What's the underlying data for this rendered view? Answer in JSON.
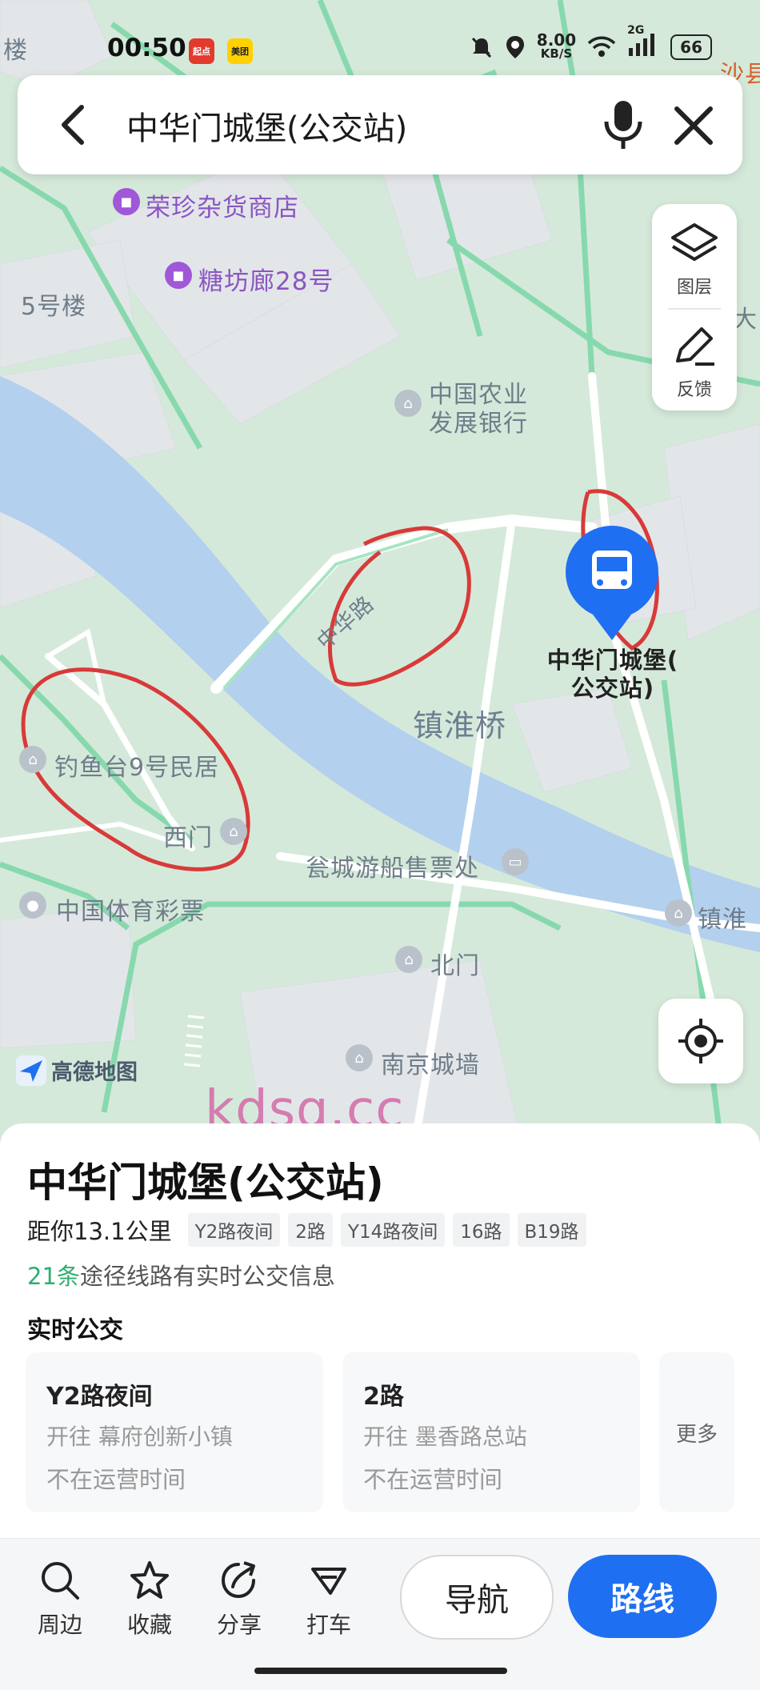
{
  "status_bar": {
    "time": "00:50",
    "app_badge_1": "起点",
    "app_badge_2": "美团",
    "net_speed_value": "8.00",
    "net_speed_unit": "KB/S",
    "signal_label": "2G",
    "battery": "66"
  },
  "search": {
    "query": "中华门城堡(公交站)"
  },
  "side_panel": {
    "layers_label": "图层",
    "feedback_label": "反馈"
  },
  "map": {
    "labels": {
      "lou": "楼",
      "shop_rongzhen": "荣珍杂货商店",
      "shop_tangfang": "糖坊廊28号",
      "building_5": "5号楼",
      "bank_line1": "中国农业",
      "bank_line2": "发展银行",
      "road_zhonghua": "中华路",
      "bridge": "镇淮桥",
      "station_line1": "中华门城堡(",
      "station_line2": "公交站)",
      "homestay": "钓鱼台9号民居",
      "west_gate": "西门",
      "ticket": "瓮城游船售票处",
      "lottery": "中国体育彩票",
      "north_gate": "北门",
      "city_wall": "南京城墙",
      "zhenhuai_edge": "镇淮",
      "sha_edge": "沙县",
      "da_edge": "大"
    },
    "brand": "高德地图",
    "watermark": "kdsq.cc",
    "accent_blue": "#1f6ff2",
    "annotation_red": "#d83a3a"
  },
  "place": {
    "title": "中华门城堡(公交站)",
    "distance": "距你13.1公里",
    "route_tags": [
      "Y2路夜间",
      "2路",
      "Y14路夜间",
      "16路",
      "B19路"
    ],
    "realtime_count": "21条",
    "realtime_text": "途径线路有实时公交信息",
    "realtime_title": "实时公交",
    "bus_cards": [
      {
        "name": "Y2路夜间",
        "dest": "开往 幕府创新小镇",
        "status": "不在运营时间"
      },
      {
        "name": "2路",
        "dest": "开往 墨香路总站",
        "status": "不在运营时间"
      }
    ],
    "more_label": "更多"
  },
  "toolbar": {
    "nearby": "周边",
    "favorite": "收藏",
    "share": "分享",
    "taxi": "打车",
    "navigate": "导航",
    "route": "路线"
  }
}
